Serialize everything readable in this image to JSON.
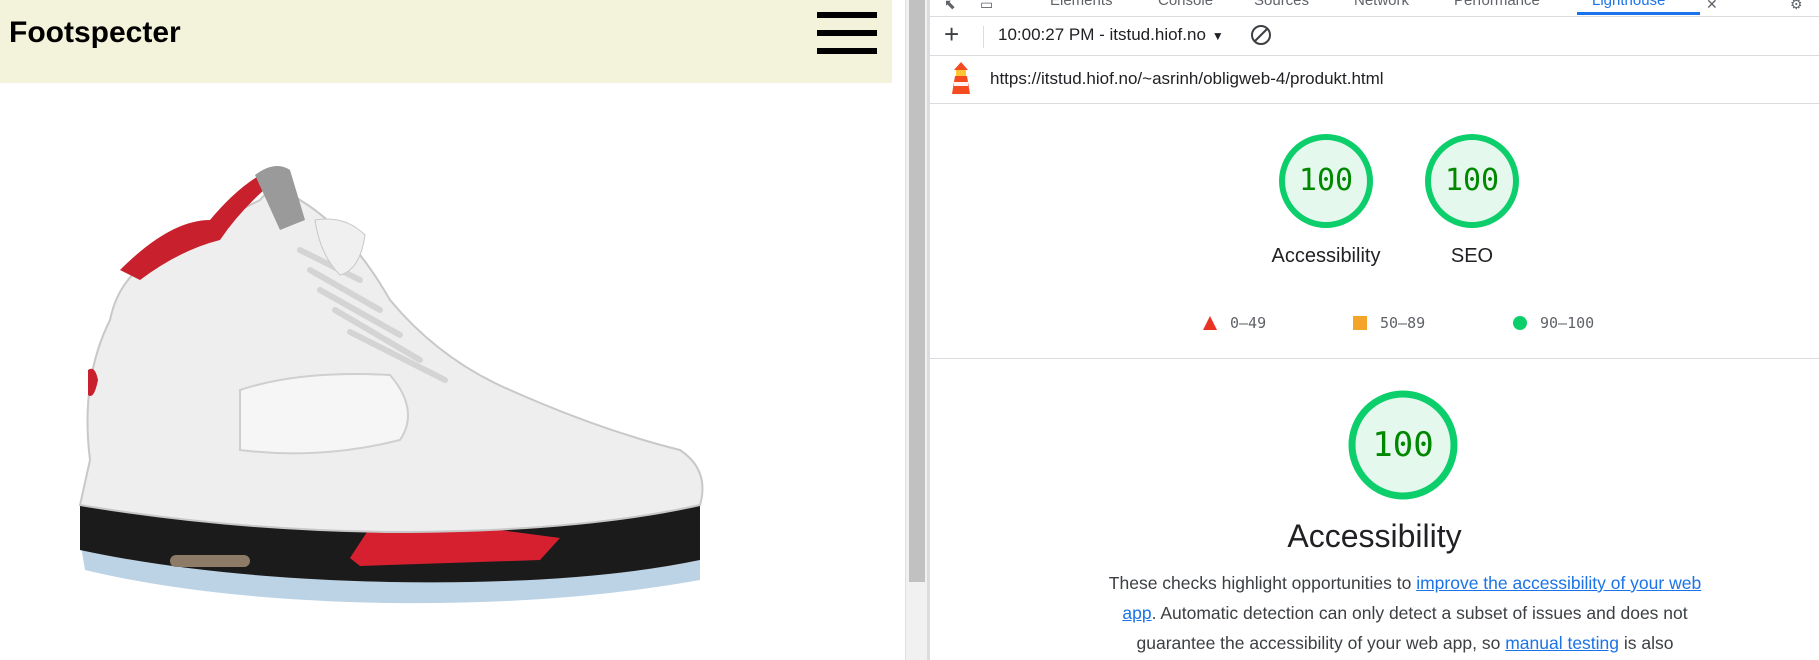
{
  "site": {
    "title": "Footspecter",
    "menu_icon": "hamburger-menu-icon",
    "product_image_alt": "Air Jordan 5 sneaker"
  },
  "devtools": {
    "tabs": [
      "Elements",
      "Console",
      "Sources",
      "Network",
      "Performance",
      "Lighthouse"
    ],
    "active_tab": "Lighthouse",
    "toolbar": {
      "report": "10:00:27 PM - itstud.hiof.no",
      "new_report_icon": "plus-icon",
      "clear_icon": "block-icon"
    },
    "url": "https://itstud.hiof.no/~asrinh/obligweb-4/produkt.html",
    "gauges": [
      {
        "score": "100",
        "label": "Accessibility"
      },
      {
        "score": "100",
        "label": "SEO"
      }
    ],
    "legend": [
      {
        "shape": "triangle",
        "color": "#eb3323",
        "label": "0–49"
      },
      {
        "shape": "square",
        "color": "#f4a429",
        "label": "50–89"
      },
      {
        "shape": "circle",
        "color": "#0cce6b",
        "label": "90–100"
      }
    ],
    "category": {
      "score": "100",
      "title": "Accessibility",
      "desc_1": "These checks highlight opportunities to ",
      "link_1": "improve the accessibility of your web app",
      "desc_2": ". Automatic detection can only detect a subset of issues and does not guarantee the accessibility of your web app, so ",
      "link_2": "manual testing",
      "desc_3": " is also"
    },
    "colors": {
      "pass": "#0cce6b",
      "pass_fill": "#e5f8ee",
      "score_text": "#008800",
      "accent": "#1a73e8",
      "header_bg": "#f3f2da"
    }
  }
}
